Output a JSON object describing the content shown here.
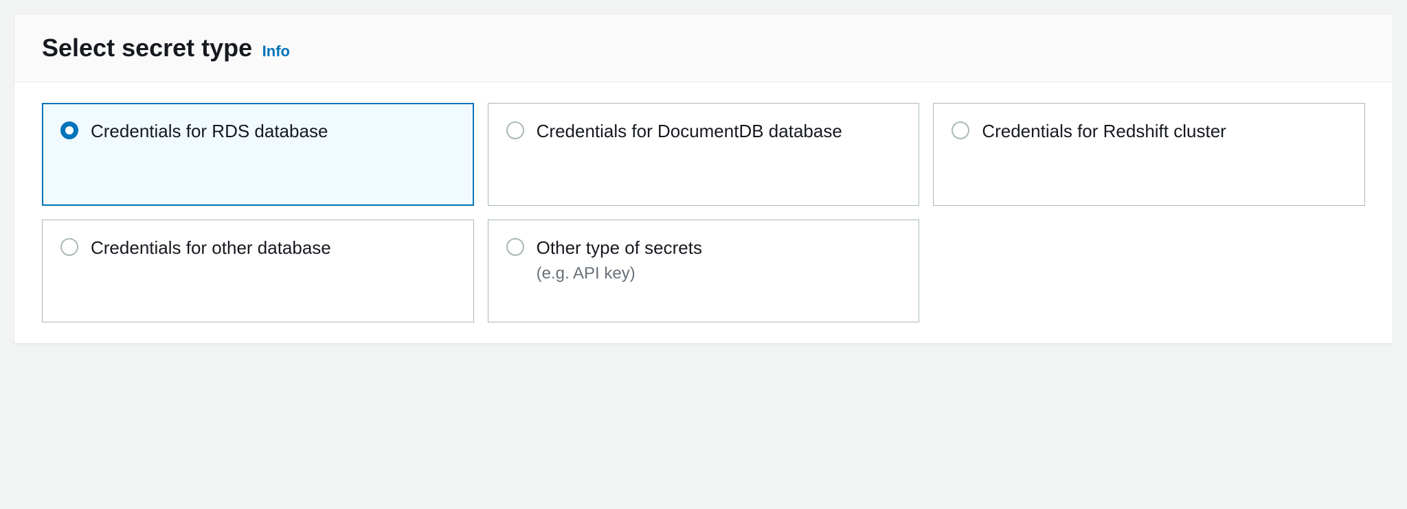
{
  "header": {
    "title": "Select secret type",
    "info_link": "Info"
  },
  "options": {
    "rds": {
      "label": "Credentials for RDS database",
      "selected": true
    },
    "documentdb": {
      "label": "Credentials for DocumentDB database",
      "selected": false
    },
    "redshift": {
      "label": "Credentials for Redshift cluster",
      "selected": false
    },
    "other_db": {
      "label": "Credentials for other database",
      "selected": false
    },
    "other_secrets": {
      "label": "Other type of secrets",
      "sublabel": "(e.g. API key)",
      "selected": false
    }
  }
}
